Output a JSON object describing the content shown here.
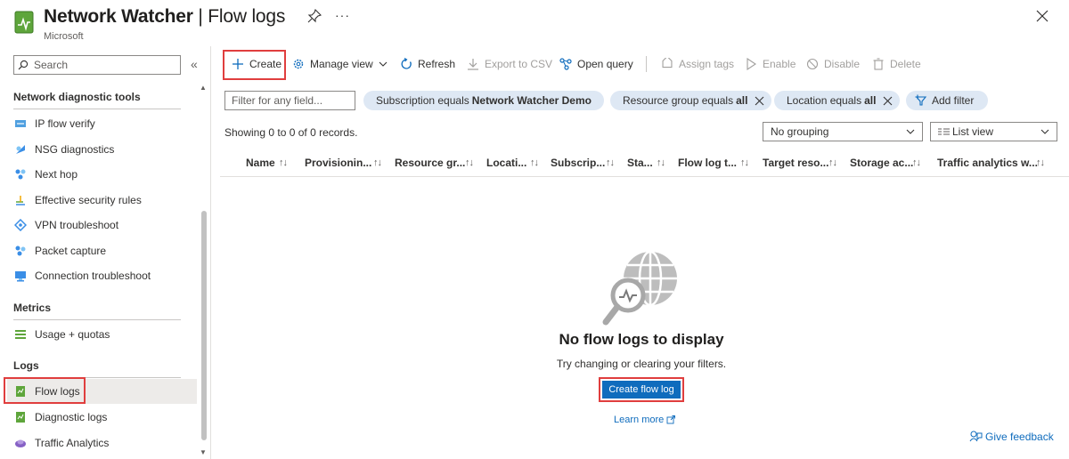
{
  "header": {
    "title_bold": "Network Watcher",
    "title_rest": " | Flow logs",
    "subtitle": "Microsoft",
    "more": "···"
  },
  "sidebar": {
    "search_placeholder": "Search",
    "collapse": "«",
    "sections": {
      "diag": "Network diagnostic tools",
      "metrics": "Metrics",
      "logs": "Logs"
    },
    "items": [
      {
        "label": "IP flow verify",
        "icon": "ip-flow-icon"
      },
      {
        "label": "NSG diagnostics",
        "icon": "nsg-diagnostics-icon"
      },
      {
        "label": "Next hop",
        "icon": "next-hop-icon"
      },
      {
        "label": "Effective security rules",
        "icon": "security-rules-icon"
      },
      {
        "label": "VPN troubleshoot",
        "icon": "vpn-icon"
      },
      {
        "label": "Packet capture",
        "icon": "packet-capture-icon"
      },
      {
        "label": "Connection troubleshoot",
        "icon": "connection-icon"
      },
      {
        "label": "Usage + quotas",
        "icon": "quotas-icon"
      },
      {
        "label": "Flow logs",
        "icon": "flow-logs-icon",
        "selected": true
      },
      {
        "label": "Diagnostic logs",
        "icon": "diagnostic-logs-icon"
      },
      {
        "label": "Traffic Analytics",
        "icon": "traffic-analytics-icon"
      }
    ]
  },
  "toolbar": {
    "create": "Create",
    "manage_view": "Manage view",
    "refresh": "Refresh",
    "export_csv": "Export to CSV",
    "open_query": "Open query",
    "assign_tags": "Assign tags",
    "enable": "Enable",
    "disable": "Disable",
    "delete": "Delete"
  },
  "filters": {
    "placeholder": "Filter for any field...",
    "pills": [
      {
        "prefix": "Subscription equals",
        "value": "Network Watcher Demo"
      },
      {
        "prefix": "Resource group equals",
        "value": "all"
      },
      {
        "prefix": "Location equals",
        "value": "all"
      }
    ],
    "add_filter": "Add filter"
  },
  "records": "Showing 0 to 0 of 0 records.",
  "grouping": "No grouping",
  "view": "List view",
  "columns": [
    "Name",
    "Provisionin...",
    "Resource gr...",
    "Locati...",
    "Subscrip...",
    "Sta...",
    "Flow log t...",
    "Target reso...",
    "Storage ac...",
    "Traffic analytics w..."
  ],
  "sort_glyph": "↑↓",
  "empty": {
    "title": "No flow logs to display",
    "subtitle": "Try changing or clearing your filters.",
    "button": "Create flow log",
    "learn_more": "Learn more"
  },
  "feedback": "Give feedback",
  "colors": {
    "accent": "#0f6cbd",
    "highlight": "#e03e3e",
    "pill_bg": "#dee8f4"
  }
}
